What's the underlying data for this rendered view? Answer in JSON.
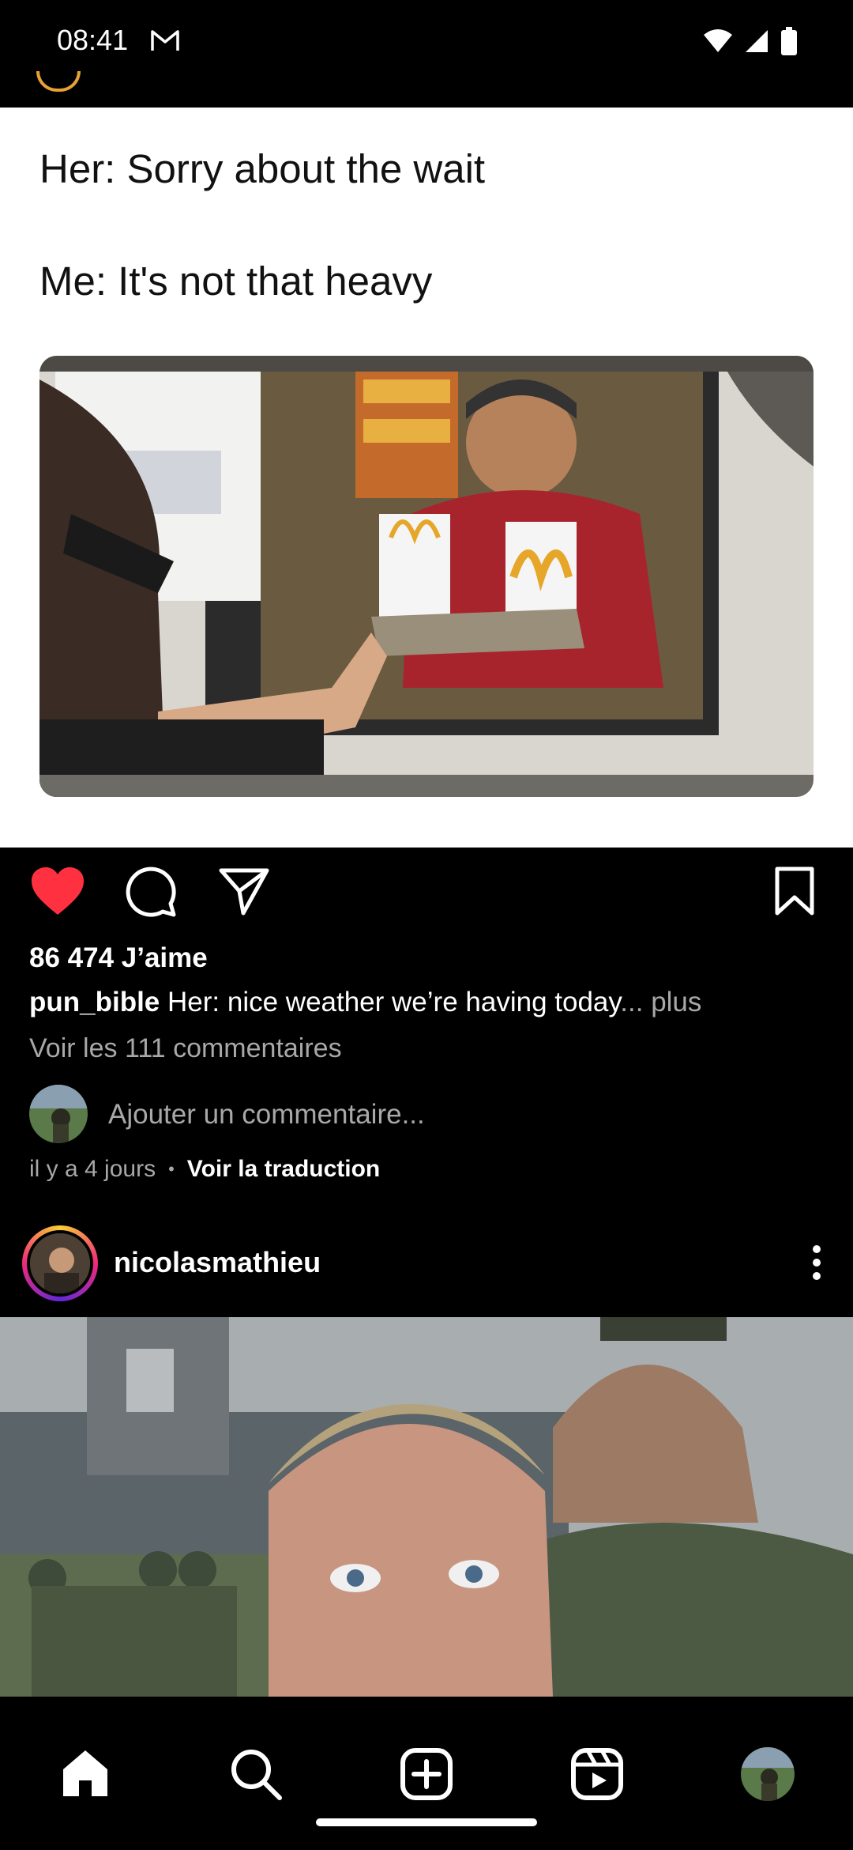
{
  "status_bar": {
    "time": "08:41"
  },
  "post": {
    "meme_line_1": "Her: Sorry about the wait",
    "meme_line_2": "Me: It's not that heavy",
    "likes": "86 474 J’aime",
    "username": "pun_bible",
    "caption": "Her: nice weather we’re having today",
    "ellipsis": "...",
    "more_label": " plus",
    "view_comments": "Voir les 111 commentaires",
    "comment_placeholder": "Ajouter un commentaire...",
    "time_ago": "il y a 4 jours",
    "separator": "•",
    "translate_label": "Voir la traduction",
    "liked": true
  },
  "next_post": {
    "username": "nicolasmathieu"
  },
  "colors": {
    "like_red": "#ff3040",
    "secondary_text": "#a8a8a8",
    "background": "#000000"
  },
  "icons": [
    "gmail-icon",
    "wifi-icon",
    "signal-icon",
    "battery-icon",
    "heart-icon",
    "comment-icon",
    "share-icon",
    "bookmark-icon",
    "more-vertical-icon",
    "home-icon",
    "search-icon",
    "create-icon",
    "reels-icon",
    "profile-avatar"
  ]
}
